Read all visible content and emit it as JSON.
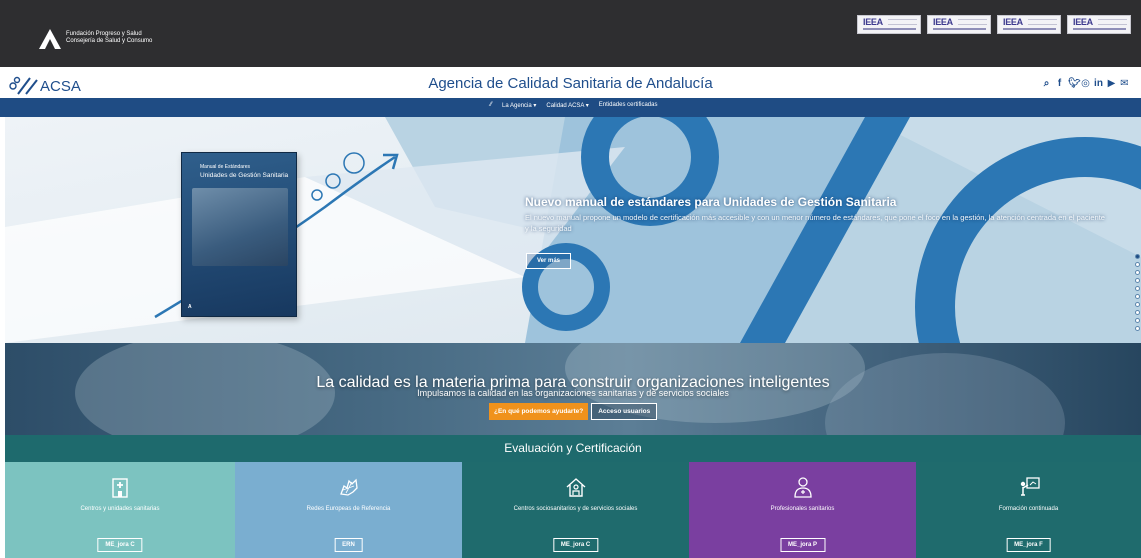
{
  "topbar": {
    "org_line1": "Fundación Progreso y Salud",
    "org_line2": "Consejería de Salud y Consumo",
    "badges": [
      "IEEA",
      "IEEA",
      "IEEA",
      "IEEA"
    ]
  },
  "header": {
    "logo_text": "ACSA",
    "title": "Agencia de Calidad Sanitaria de Andalucía",
    "social_icons": [
      "search-icon",
      "facebook-icon",
      "twitter-icon",
      "instagram-icon",
      "linkedin-icon",
      "youtube-icon",
      "mail-icon"
    ]
  },
  "nav": {
    "items": [
      "La Agencia ▾",
      "Calidad ACSA ▾",
      "Entidades certificadas"
    ]
  },
  "hero": {
    "book_title_small": "Manual de Estándares",
    "book_title": "Unidades de Gestión Sanitaria",
    "title": "Nuevo manual de estándares para Unidades de Gestión Sanitaria",
    "description": "El nuevo manual propone un modelo de certificación más accesible y con un menor número de estándares, que pone el foco en la gestión, la atención centrada en el paciente y la seguridad",
    "button": "Ver más",
    "slide_count": 10,
    "active_slide": 0
  },
  "band": {
    "title": "La calidad es la materia prima para construir organizaciones inteligentes",
    "subtitle": "Impulsamos la calidad en las organizaciones sanitarias y de servicios sociales",
    "help_button": "¿En qué podemos ayudarte?",
    "access_button": "Acceso usuarios"
  },
  "section": {
    "title": "Evaluación y Certificación"
  },
  "cards": [
    {
      "title": "Centros y unidades sanitarias",
      "button": "ME_jora C",
      "color": "#7cc3c0",
      "icon": "hospital-icon"
    },
    {
      "title": "Redes Europeas de Referencia",
      "button": "ERN",
      "color": "#7aaed0",
      "icon": "europe-map-icon"
    },
    {
      "title": "Centros sociosanitarios y de servicios sociales",
      "button": "ME_jora C",
      "color": "#1f6b6d",
      "icon": "house-person-icon"
    },
    {
      "title": "Profesionales sanitarios",
      "button": "ME_jora P",
      "color": "#7a3fa0",
      "icon": "doctor-icon"
    },
    {
      "title": "Formación continuada",
      "button": "ME_jora F",
      "color": "#1f6b6d",
      "icon": "teacher-board-icon"
    }
  ],
  "colors": {
    "topbar": "#2e2e30",
    "brand_blue": "#1f4c84",
    "teal": "#1e6a6d",
    "orange": "#f0921c"
  }
}
